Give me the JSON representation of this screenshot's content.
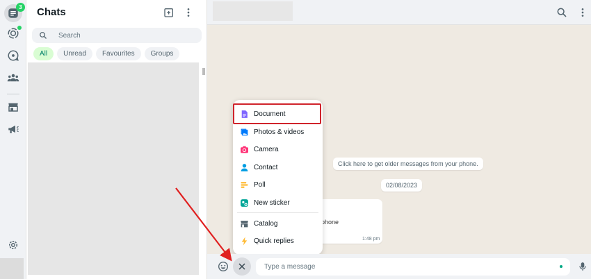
{
  "rail": {
    "chats_badge": "3",
    "icons": [
      "chats-icon",
      "status-icon",
      "channels-icon",
      "communities-icon",
      "catalog-icon",
      "broadcast-icon",
      "settings-icon"
    ]
  },
  "chatlist": {
    "title": "Chats",
    "search_placeholder": "Search",
    "filters": [
      "All",
      "Unread",
      "Favourites",
      "Groups"
    ],
    "active_filter": "All"
  },
  "conversation": {
    "older_messages_text": "Click here to get older messages from your phone.",
    "date_label": "02/08/2023",
    "message_fragment": "phone",
    "message_time": "1:48 pm"
  },
  "attach_menu": {
    "items": [
      {
        "label": "Document",
        "icon": "document-icon",
        "color": "#7f66ff"
      },
      {
        "label": "Photos & videos",
        "icon": "photos-icon",
        "color": "#007bfc"
      },
      {
        "label": "Camera",
        "icon": "camera-icon",
        "color": "#ff2e74"
      },
      {
        "label": "Contact",
        "icon": "contact-icon",
        "color": "#009de2"
      },
      {
        "label": "Poll",
        "icon": "poll-icon",
        "color": "#ffbc38"
      },
      {
        "label": "New sticker",
        "icon": "sticker-icon",
        "color": "#02a698"
      },
      {
        "label": "Catalog",
        "icon": "catalog-icon",
        "color": "#54656f"
      },
      {
        "label": "Quick replies",
        "icon": "quick-replies-icon",
        "color": "#ffbc38"
      }
    ],
    "highlighted": "Document",
    "highlight_color": "#d0232b"
  },
  "composer": {
    "placeholder": "Type a message"
  },
  "colors": {
    "accent_green": "#25d366",
    "active_chip_bg": "#d9fdd3",
    "active_chip_text": "#008069",
    "arrow": "#e02020"
  }
}
